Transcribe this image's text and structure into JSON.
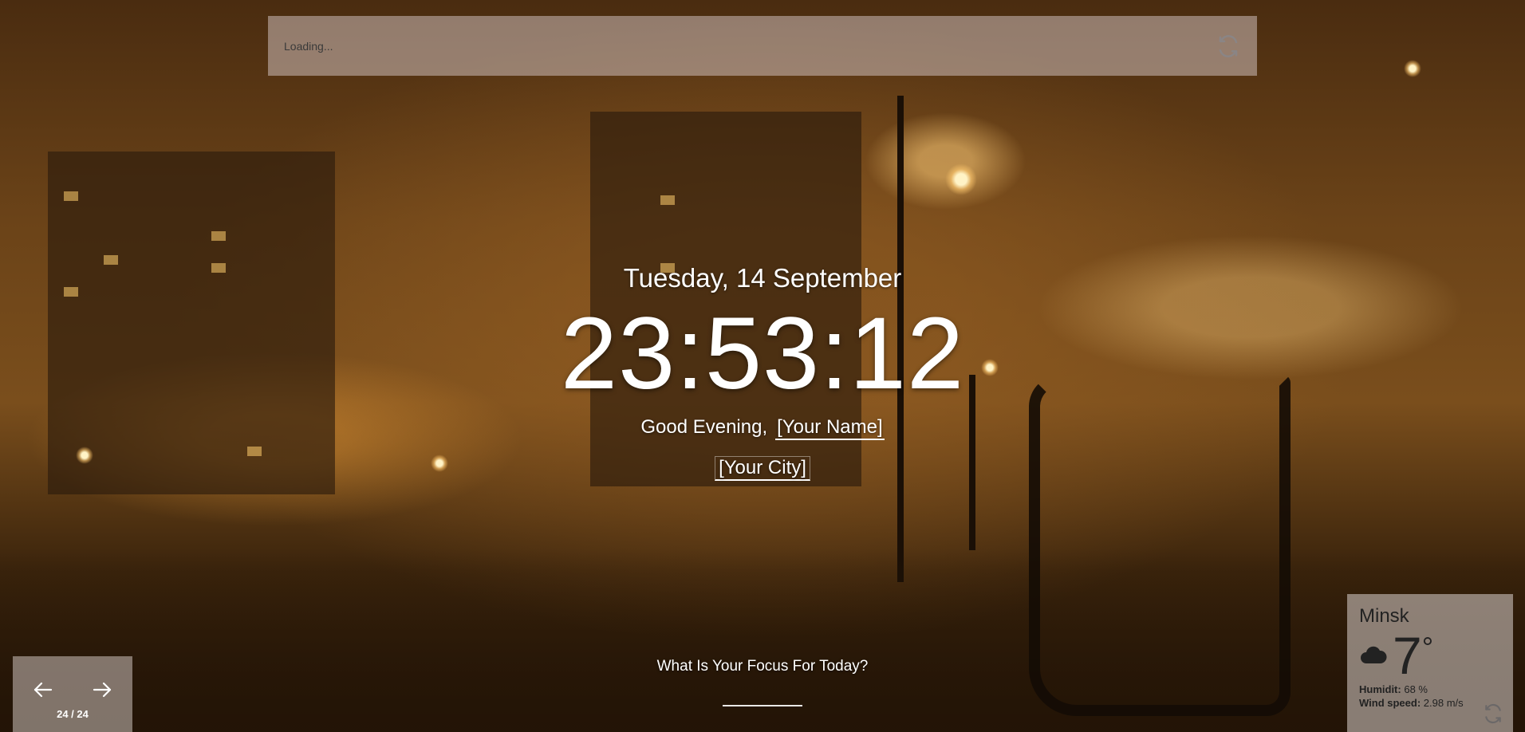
{
  "quote": {
    "text": "Loading..."
  },
  "date": "Tuesday, 14 September",
  "time": "23:53:12",
  "greeting": {
    "prefix": "Good Evening,",
    "name": "[Your Name]"
  },
  "city": "[Your City]",
  "focus": {
    "prompt": "What Is Your Focus For Today?"
  },
  "slider": {
    "counter": "24 / 24"
  },
  "weather": {
    "city": "Minsk",
    "icon": "cloud-icon",
    "temperature": "7",
    "degree": "°",
    "humidity_label": "Humidit:",
    "humidity_value": "68 %",
    "wind_label": "Wind speed:",
    "wind_value": "2.98 m/s"
  },
  "colors": {
    "panel": "#cdbeb9",
    "text_dark": "#222222"
  }
}
